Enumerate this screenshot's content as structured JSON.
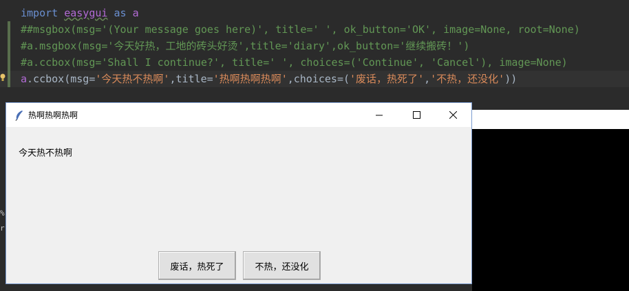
{
  "editor": {
    "line1": {
      "kw_import": "import",
      "module": "easygui",
      "kw_as": "as",
      "alias": "a"
    },
    "line2": {
      "comment": "##msgbox(msg='(Your message goes here)', title=' ', ok_button='OK', image=None, root=None)"
    },
    "line3": {
      "comment": "#a.msgbox(msg='今天好热，工地的砖头好烫',title='diary',ok_button='继续搬砖！')"
    },
    "line4": {
      "comment": "#a.ccbox(msg='Shall I continue?', title=' ', choices=('Continue', 'Cancel'), image=None)"
    },
    "line5": {
      "obj": "a",
      "call_open": ".ccbox(msg=",
      "msg_str": "'今天热不热啊'",
      "title_kw": ",title=",
      "title_str": "'热啊热啊热啊'",
      "choices_kw": ",choices=(",
      "choice1_str": "'废话，热死了'",
      "comma": ",",
      "choice2_str": "'不热，还没化'",
      "close": "))"
    }
  },
  "terminal": {
    "left_chars": "%\nr"
  },
  "dialog": {
    "title": "热啊热啊热啊",
    "message": "今天热不热啊",
    "choices": [
      "废话，热死了",
      "不热，还没化"
    ],
    "controls": {
      "minimize_icon": "minimize-icon",
      "maximize_icon": "maximize-icon",
      "close_icon": "close-icon"
    }
  },
  "colors": {
    "editor_bg": "#2b2b2b",
    "keyword": "#6a8fd0",
    "comment": "#629755",
    "string": "#d98a5a",
    "dialog_bg": "#f0f0f0"
  }
}
